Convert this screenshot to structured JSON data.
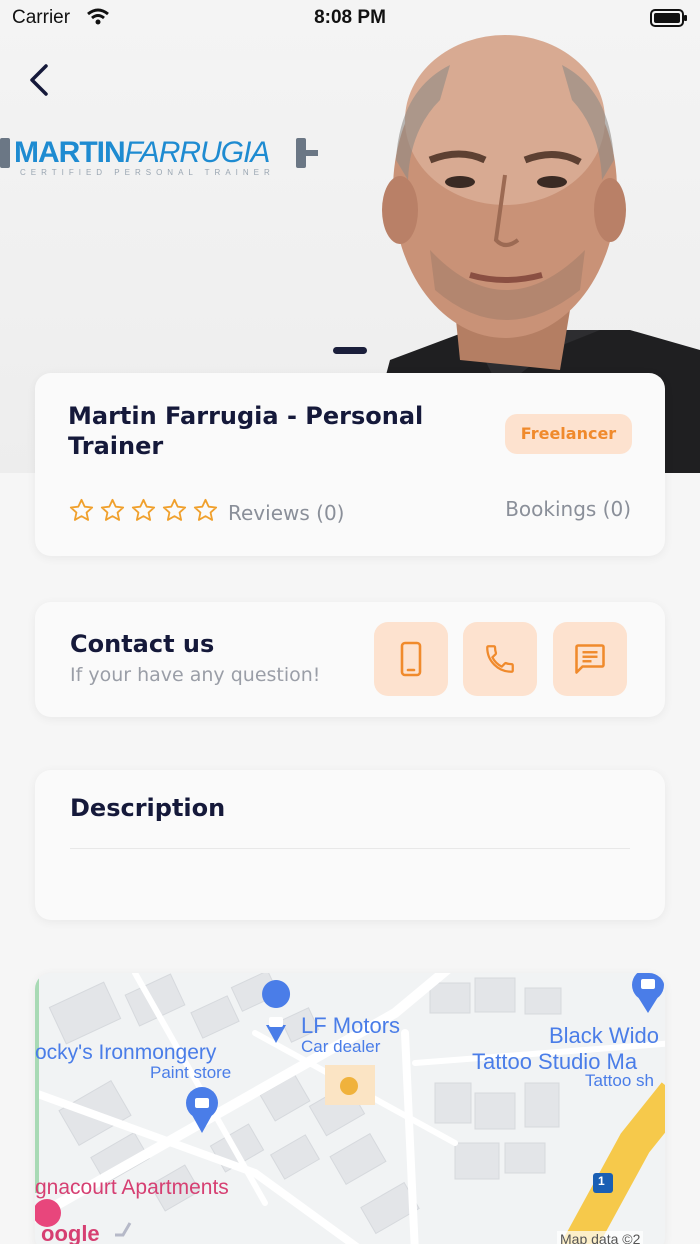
{
  "status_bar": {
    "carrier": "Carrier",
    "time": "8:08 PM"
  },
  "hero": {
    "logo_brand_bold": "MARTIN",
    "logo_brand_italic": "FARRUGIA",
    "logo_tagline": "CERTIFIED PERSONAL TRAINER",
    "page_indicator": {
      "count": 1,
      "active": 0
    }
  },
  "provider": {
    "name": "Martin Farrugia - Personal Trainer",
    "badge": "Freelancer",
    "rating": 0,
    "rating_max": 5,
    "reviews_label": "Reviews (0)",
    "bookings_label": "Bookings (0)"
  },
  "contact": {
    "title": "Contact us",
    "subtitle": "If your have any question!",
    "buttons": [
      "mobile-icon",
      "phone-icon",
      "chat-icon"
    ]
  },
  "description": {
    "title": "Description"
  },
  "map": {
    "labels": {
      "lf_motors": "LF Motors",
      "car_dealer": "Car dealer",
      "ironmongery": "ocky's Ironmongery",
      "paint_store": "Paint store",
      "black_widow": "Black Wido",
      "tattoo_studio": "Tattoo Studio Ma",
      "tattoo_sh": "Tattoo sh",
      "apartments": "gnacourt Apartments",
      "google": "oogle",
      "route_number": "1",
      "map_data": "Map data ©2"
    }
  },
  "colors": {
    "accent": "#f08a2c",
    "accent_bg": "#fde2cf",
    "primary_text": "#15193a",
    "muted_text": "#8a8f99",
    "background": "#f6f6f6"
  }
}
